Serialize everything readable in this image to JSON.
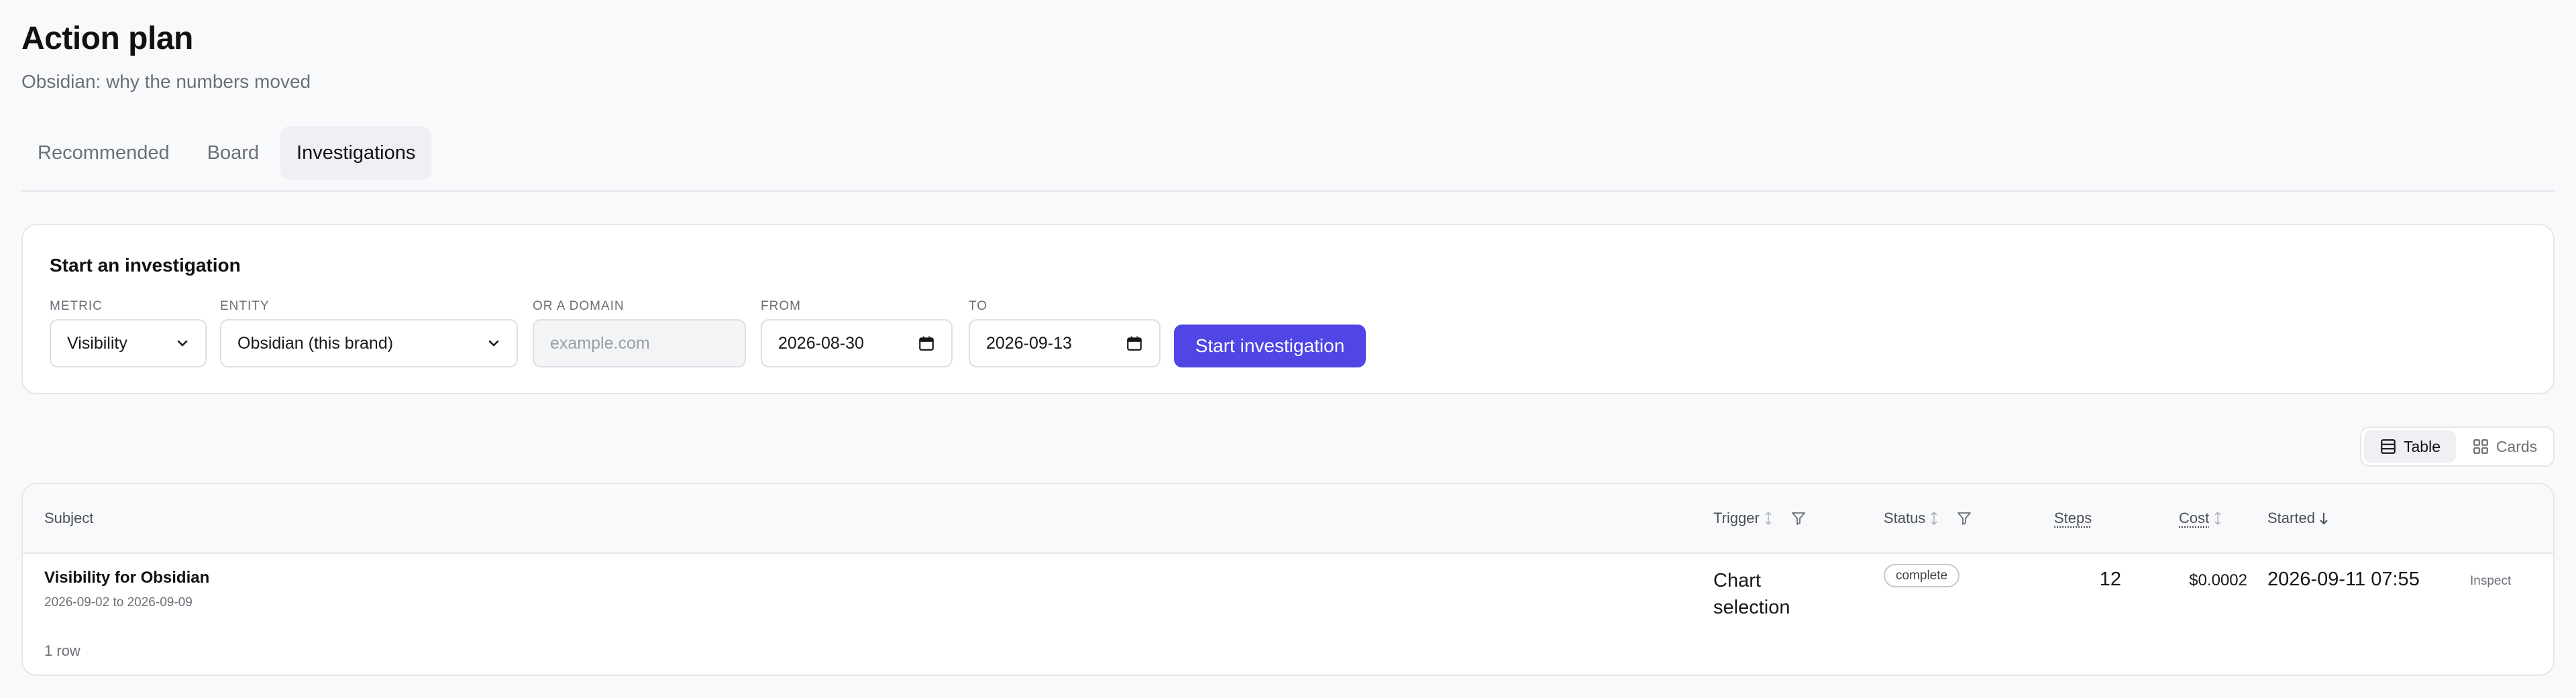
{
  "page": {
    "title": "Action plan",
    "subtitle": "Obsidian: why the numbers moved"
  },
  "tabs": [
    {
      "label": "Recommended",
      "active": false
    },
    {
      "label": "Board",
      "active": false
    },
    {
      "label": "Investigations",
      "active": true
    }
  ],
  "form": {
    "title": "Start an investigation",
    "metric": {
      "label": "METRIC",
      "value": "Visibility"
    },
    "entity": {
      "label": "ENTITY",
      "value": "Obsidian (this brand)"
    },
    "domain": {
      "label": "OR A DOMAIN",
      "placeholder": "example.com"
    },
    "from": {
      "label": "FROM",
      "value": "2026-08-30"
    },
    "to": {
      "label": "TO",
      "value": "2026-09-13"
    },
    "submit_label": "Start investigation"
  },
  "view_toggle": {
    "options": [
      {
        "label": "Table",
        "icon": "table-icon",
        "active": true
      },
      {
        "label": "Cards",
        "icon": "grid-icon",
        "active": false
      }
    ]
  },
  "table": {
    "columns": {
      "subject": "Subject",
      "trigger": "Trigger",
      "status": "Status",
      "steps": "Steps",
      "cost": "Cost",
      "started": "Started"
    },
    "rows": [
      {
        "subject": "Visibility for Obsidian",
        "range": "2026-09-02 to 2026-09-09",
        "trigger": "Chart selection",
        "status": "complete",
        "steps": "12",
        "cost": "$0.0002",
        "started": "2026-09-11 07:55",
        "action": "Inspect"
      }
    ],
    "row_count": "1 row"
  },
  "colors": {
    "accent": "#4f46e5",
    "background": "#f8f9fb",
    "card": "#ffffff",
    "muted_text": "#6b6f76",
    "border": "#e4e6ea"
  }
}
